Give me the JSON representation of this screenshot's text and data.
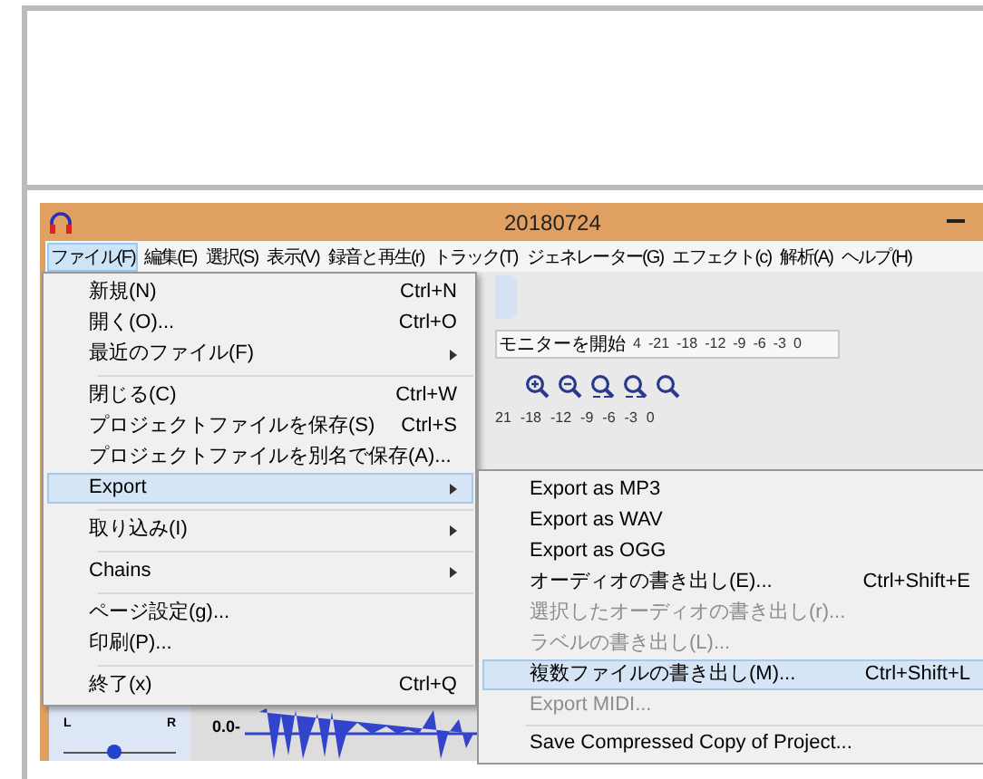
{
  "window": {
    "title": "20180724"
  },
  "menu_bar": [
    {
      "label": "ファイル(F)",
      "selected": true
    },
    {
      "label": "編集(E)",
      "selected": false
    },
    {
      "label": "選択(S)",
      "selected": false
    },
    {
      "label": "表示(V)",
      "selected": false
    },
    {
      "label": "録音と再生(r)",
      "selected": false
    },
    {
      "label": "トラック(T)",
      "selected": false
    },
    {
      "label": "ジェネレーター(G)",
      "selected": false
    },
    {
      "label": "エフェクト(c)",
      "selected": false
    },
    {
      "label": "解析(A)",
      "selected": false
    },
    {
      "label": "ヘルプ(H)",
      "selected": false
    }
  ],
  "toolbar": {
    "meter_label": "モニターを開始",
    "meter_ticks": [
      "4",
      "-21",
      "-18",
      "-12",
      "-9",
      "-6",
      "-3",
      "0"
    ],
    "ruler_ticks": [
      "21",
      "-18",
      "-12",
      "-9",
      "-6",
      "-3",
      "0"
    ]
  },
  "track": {
    "pan_left": "L",
    "pan_right": "R",
    "pan": {
      "level": 0.45
    },
    "gain_label": "0.0-"
  },
  "file_menu": [
    {
      "kind": "item",
      "label": "新規(N)",
      "shortcut": "Ctrl+N",
      "submenu": false,
      "selected": false
    },
    {
      "kind": "item",
      "label": "開く(O)...",
      "shortcut": "Ctrl+O",
      "submenu": false,
      "selected": false
    },
    {
      "kind": "item",
      "label": "最近のファイル(F)",
      "submenu": true,
      "selected": false
    },
    {
      "kind": "separator"
    },
    {
      "kind": "item",
      "label": "閉じる(C)",
      "shortcut": "Ctrl+W",
      "submenu": false,
      "selected": false
    },
    {
      "kind": "item",
      "label": "プロジェクトファイルを保存(S)",
      "shortcut": "Ctrl+S",
      "submenu": false,
      "selected": false
    },
    {
      "kind": "item",
      "label": "プロジェクトファイルを別名で保存(A)...",
      "submenu": false,
      "selected": false
    },
    {
      "kind": "item",
      "label": "Export",
      "submenu": true,
      "selected": true
    },
    {
      "kind": "separator"
    },
    {
      "kind": "item",
      "label": "取り込み(I)",
      "submenu": true,
      "selected": false
    },
    {
      "kind": "separator"
    },
    {
      "kind": "item",
      "label": "Chains",
      "submenu": true,
      "selected": false
    },
    {
      "kind": "separator"
    },
    {
      "kind": "item",
      "label": "ページ設定(g)...",
      "submenu": false,
      "selected": false
    },
    {
      "kind": "item",
      "label": "印刷(P)...",
      "submenu": false,
      "selected": false
    },
    {
      "kind": "separator"
    },
    {
      "kind": "item",
      "label": "終了(x)",
      "shortcut": "Ctrl+Q",
      "submenu": false,
      "selected": false
    }
  ],
  "export_menu": [
    {
      "kind": "item",
      "label": "Export as MP3",
      "disabled": false,
      "selected": false
    },
    {
      "kind": "item",
      "label": "Export as WAV",
      "disabled": false,
      "selected": false
    },
    {
      "kind": "item",
      "label": "Export as OGG",
      "disabled": false,
      "selected": false
    },
    {
      "kind": "item",
      "label": "オーディオの書き出し(E)...",
      "shortcut": "Ctrl+Shift+E",
      "disabled": false,
      "selected": false
    },
    {
      "kind": "item",
      "label": "選択したオーディオの書き出し(r)...",
      "disabled": true,
      "selected": false
    },
    {
      "kind": "item",
      "label": "ラベルの書き出し(L)...",
      "disabled": true,
      "selected": false
    },
    {
      "kind": "item",
      "label": "複数ファイルの書き出し(M)...",
      "shortcut": "Ctrl+Shift+L",
      "disabled": false,
      "selected": true
    },
    {
      "kind": "item",
      "label": "Export MIDI...",
      "disabled": true,
      "selected": false
    },
    {
      "kind": "separator"
    },
    {
      "kind": "item",
      "label": "Save Compressed Copy of Project...",
      "disabled": false,
      "selected": false
    }
  ]
}
